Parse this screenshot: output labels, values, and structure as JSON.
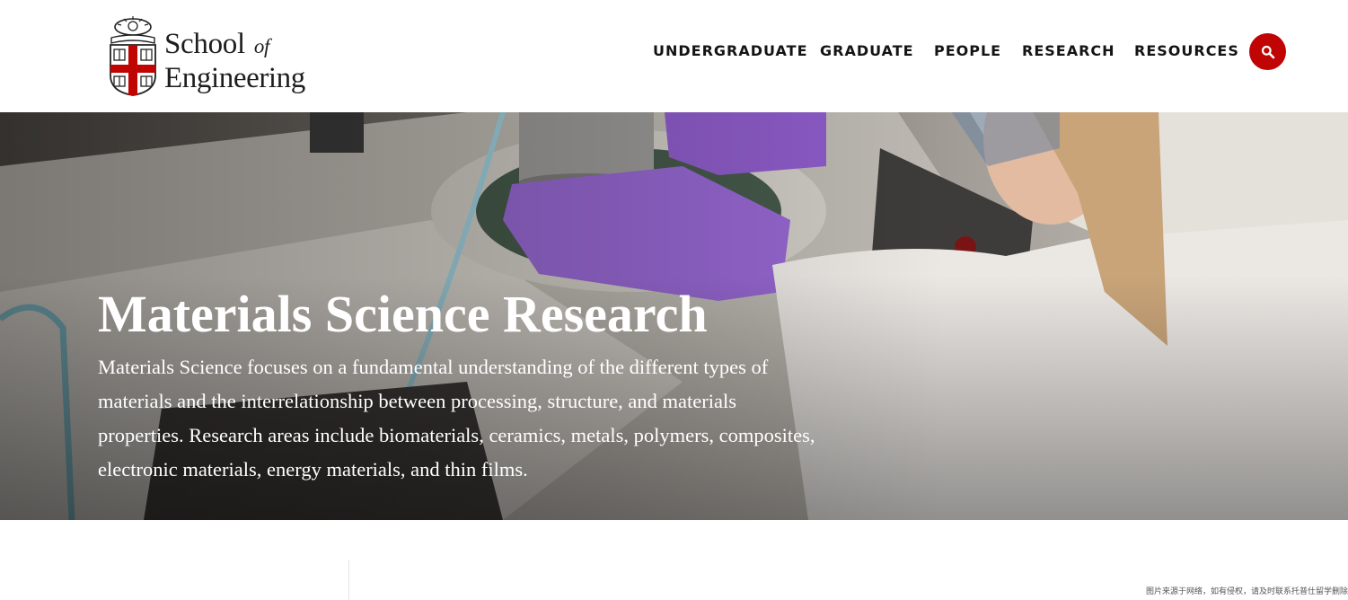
{
  "logo": {
    "line1": "School",
    "line1_italic": "of",
    "line2": "Engineering",
    "brand_red": "#c00404"
  },
  "nav": {
    "items": [
      {
        "label": "UNDERGRADUATE"
      },
      {
        "label": "GRADUATE"
      },
      {
        "label": "PEOPLE"
      },
      {
        "label": "RESEARCH"
      },
      {
        "label": "RESOURCES"
      }
    ],
    "search_icon": "search-icon"
  },
  "hero": {
    "title": "Materials Science Research",
    "description": "Materials Science focuses on a fundamental understanding of the different types of materials and the interrelationship between processing, structure, and materials properties. Research areas include biomaterials, ceramics, metals, polymers, composites, electronic materials, energy materials, and thin films."
  },
  "watermark": "图片来源于网络，如有侵权，请及时联系托普仕留学删除"
}
